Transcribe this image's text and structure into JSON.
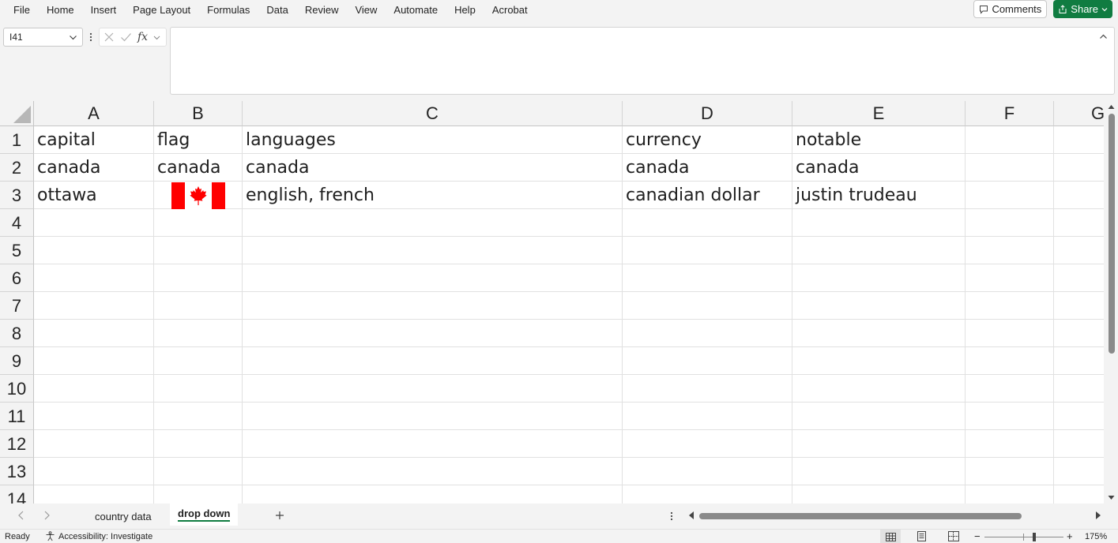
{
  "menu": {
    "items": [
      "File",
      "Home",
      "Insert",
      "Page Layout",
      "Formulas",
      "Data",
      "Review",
      "View",
      "Automate",
      "Help",
      "Acrobat"
    ],
    "comments_label": "Comments",
    "share_label": "Share"
  },
  "formula_bar": {
    "name_box": "I41",
    "fx_label": "fx",
    "formula": ""
  },
  "grid": {
    "columns": [
      "A",
      "B",
      "C",
      "D",
      "E",
      "F",
      "G"
    ],
    "rows": [
      "1",
      "2",
      "3",
      "4",
      "5",
      "6",
      "7",
      "8",
      "9",
      "10",
      "11",
      "12",
      "13",
      "14"
    ],
    "cells": [
      [
        "capital",
        "flag",
        "languages",
        "currency",
        "notable",
        "",
        ""
      ],
      [
        "canada",
        "canada",
        "canada",
        "canada",
        "canada",
        "",
        ""
      ],
      [
        "ottawa",
        "",
        "english, french",
        "canadian dollar",
        "justin trudeau",
        "",
        ""
      ]
    ],
    "flag_colors": {
      "red": "#ff0000",
      "white": "#ffffff"
    }
  },
  "sheets": {
    "tabs": [
      "country data",
      "drop down"
    ],
    "active": "drop down"
  },
  "status": {
    "ready": "Ready",
    "accessibility": "Accessibility: Investigate",
    "zoom": "175%"
  },
  "colors": {
    "accent": "#107c41"
  }
}
